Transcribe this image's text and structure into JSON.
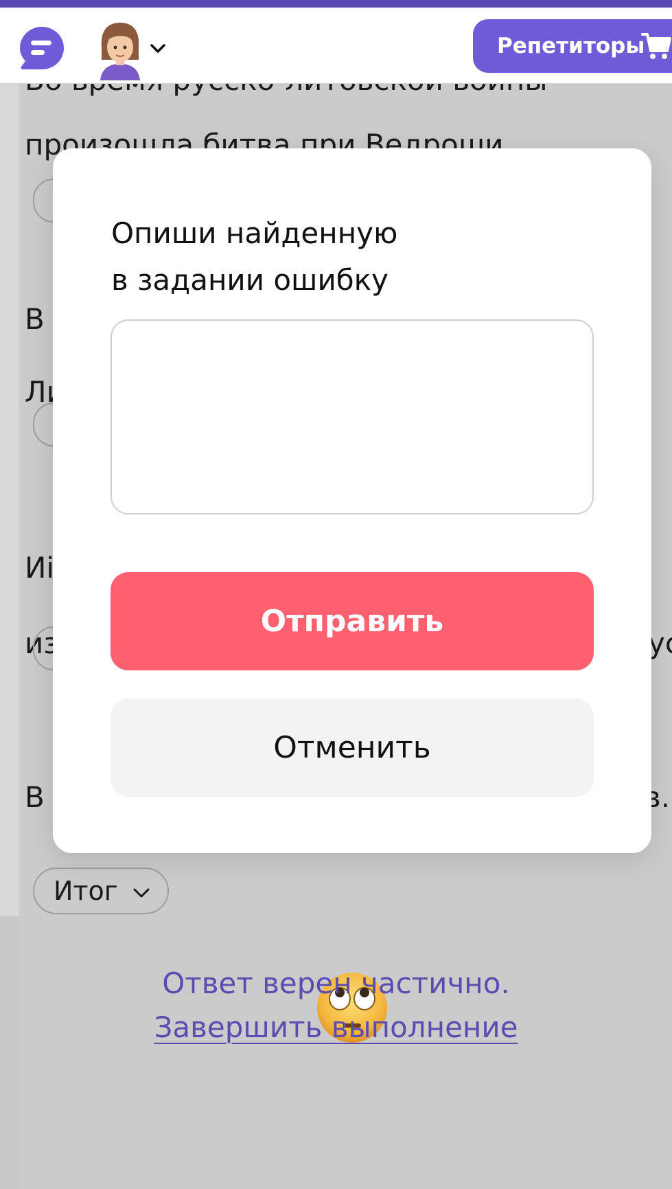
{
  "header": {
    "tutors_button_label": "Репетиторы",
    "colors": {
      "accent": "#6f5bd8",
      "strip": "#5b47b0"
    }
  },
  "background": {
    "lines": [
      "Во время русско-литовской войны",
      "произошла битва при Ведроши",
      "В",
      "Ли",
      "Иі",
      "из",
      "ус",
      "В",
      "в."
    ],
    "summary_button_label": "Итог",
    "result_text": "Ответ верен частично.",
    "finish_link": "Завершить выполнение"
  },
  "modal": {
    "title_line1": "Опиши найденную",
    "title_line2": "в задании ошибку",
    "textarea_value": "",
    "send_label": "Отправить",
    "cancel_label": "Отменить",
    "colors": {
      "send": "#fe6070",
      "cancel": "#f3f3f3"
    }
  }
}
